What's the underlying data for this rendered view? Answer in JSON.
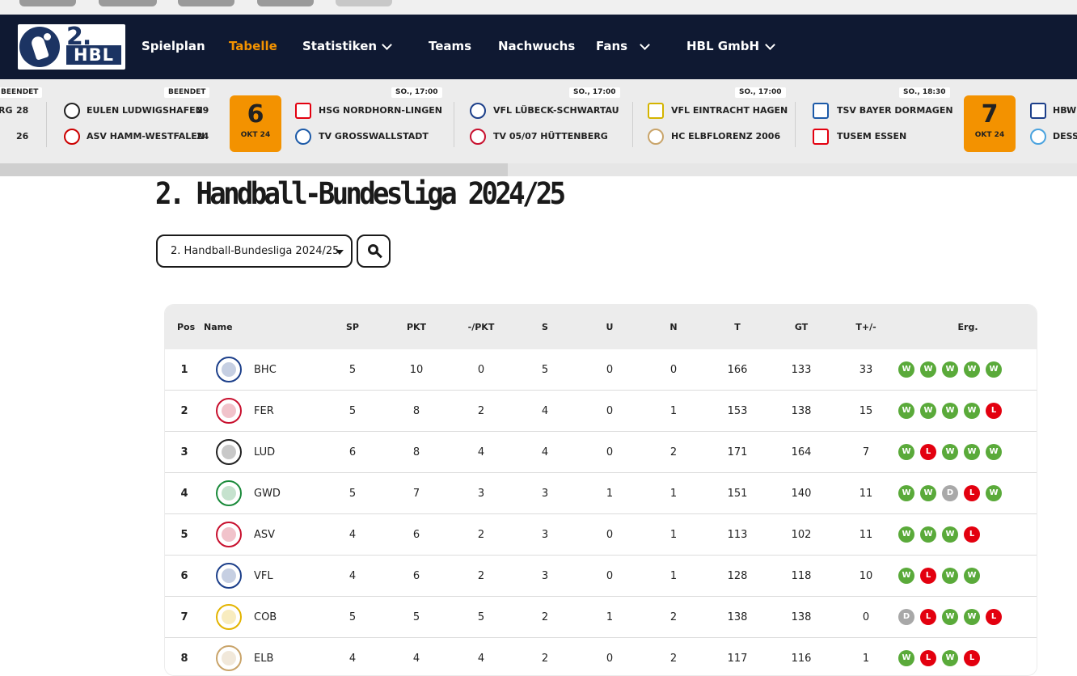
{
  "nav": {
    "logo": {
      "two": "2.",
      "hbl": "HBL"
    },
    "items": [
      {
        "label": "Spielplan",
        "active": false,
        "dropdown": false
      },
      {
        "label": "Tabelle",
        "active": true,
        "dropdown": false
      },
      {
        "label": "Statistiken",
        "active": false,
        "dropdown": true
      },
      {
        "label": "Teams",
        "active": false,
        "dropdown": false
      },
      {
        "label": "Nachwuchs",
        "active": false,
        "dropdown": false
      },
      {
        "label": "Fans",
        "active": false,
        "dropdown": true
      },
      {
        "label": "HBL GmbH",
        "active": false,
        "dropdown": true
      }
    ],
    "accent": "#f39200",
    "background": "#0f1932"
  },
  "ticker": {
    "games": [
      {
        "status": "BEENDET",
        "home": "RG",
        "home_score": "28",
        "away": "",
        "away_score": "26",
        "partial": true
      },
      {
        "status": "BEENDET",
        "home": "EULEN LUDWIGSHAFEN",
        "home_score": "29",
        "away": "ASV HAMM-WESTFALEN",
        "away_score": "24"
      },
      {
        "status": "SO., 17:00",
        "home": "HSG NORDHORN-LINGEN",
        "away": "TV GROSSWALLSTADT"
      },
      {
        "status": "SO., 17:00",
        "home": "VFL LÜBECK-SCHWARTAU",
        "away": "TV 05/07 HÜTTENBERG"
      },
      {
        "status": "SO., 17:00",
        "home": "VFL EINTRACHT HAGEN",
        "away": "HC ELBFLORENZ 2006"
      },
      {
        "status": "SO., 18:30",
        "home": "TSV BAYER DORMAGEN",
        "away": "TUSEM ESSEN"
      },
      {
        "status": "",
        "home": "HBW",
        "away": "DESS",
        "partial": true
      }
    ],
    "days": [
      {
        "num": "6",
        "month": "OKT 24"
      },
      {
        "num": "7",
        "month": "OKT 24"
      }
    ]
  },
  "page": {
    "title": "2. Handball-Bundesliga 2024/25",
    "season_select": {
      "value": "2. Handball-Bundesliga 2024/25"
    },
    "search_icon": "search-icon"
  },
  "table": {
    "headers": [
      "Pos",
      "Name",
      "SP",
      "PKT",
      "-/PKT",
      "S",
      "U",
      "N",
      "T",
      "GT",
      "T+/-",
      "Erg."
    ],
    "rows": [
      {
        "pos": "1",
        "name": "BHC",
        "sp": "5",
        "pkt": "10",
        "mpkt": "0",
        "s": "5",
        "u": "0",
        "n": "0",
        "t": "166",
        "gt": "133",
        "diff": "33",
        "results": [
          "W",
          "W",
          "W",
          "W",
          "W"
        ]
      },
      {
        "pos": "2",
        "name": "FER",
        "sp": "5",
        "pkt": "8",
        "mpkt": "2",
        "s": "4",
        "u": "0",
        "n": "1",
        "t": "153",
        "gt": "138",
        "diff": "15",
        "results": [
          "W",
          "W",
          "W",
          "W",
          "L"
        ]
      },
      {
        "pos": "3",
        "name": "LUD",
        "sp": "6",
        "pkt": "8",
        "mpkt": "4",
        "s": "4",
        "u": "0",
        "n": "2",
        "t": "171",
        "gt": "164",
        "diff": "7",
        "results": [
          "W",
          "L",
          "W",
          "W",
          "W"
        ]
      },
      {
        "pos": "4",
        "name": "GWD",
        "sp": "5",
        "pkt": "7",
        "mpkt": "3",
        "s": "3",
        "u": "1",
        "n": "1",
        "t": "151",
        "gt": "140",
        "diff": "11",
        "results": [
          "W",
          "W",
          "D",
          "L",
          "W"
        ]
      },
      {
        "pos": "5",
        "name": "ASV",
        "sp": "4",
        "pkt": "6",
        "mpkt": "2",
        "s": "3",
        "u": "0",
        "n": "1",
        "t": "113",
        "gt": "102",
        "diff": "11",
        "results": [
          "W",
          "W",
          "W",
          "L"
        ]
      },
      {
        "pos": "6",
        "name": "VFL",
        "sp": "4",
        "pkt": "6",
        "mpkt": "2",
        "s": "3",
        "u": "0",
        "n": "1",
        "t": "128",
        "gt": "118",
        "diff": "10",
        "results": [
          "W",
          "L",
          "W",
          "W"
        ]
      },
      {
        "pos": "7",
        "name": "COB",
        "sp": "5",
        "pkt": "5",
        "mpkt": "5",
        "s": "2",
        "u": "1",
        "n": "2",
        "t": "138",
        "gt": "138",
        "diff": "0",
        "results": [
          "D",
          "L",
          "W",
          "W",
          "L"
        ]
      },
      {
        "pos": "8",
        "name": "ELB",
        "sp": "4",
        "pkt": "4",
        "mpkt": "4",
        "s": "2",
        "u": "0",
        "n": "2",
        "t": "117",
        "gt": "116",
        "diff": "1",
        "results": [
          "W",
          "L",
          "W",
          "L"
        ]
      }
    ],
    "result_colors": {
      "W": "#5aaa3a",
      "L": "#e3000f",
      "D": "#a8a8a8"
    }
  }
}
